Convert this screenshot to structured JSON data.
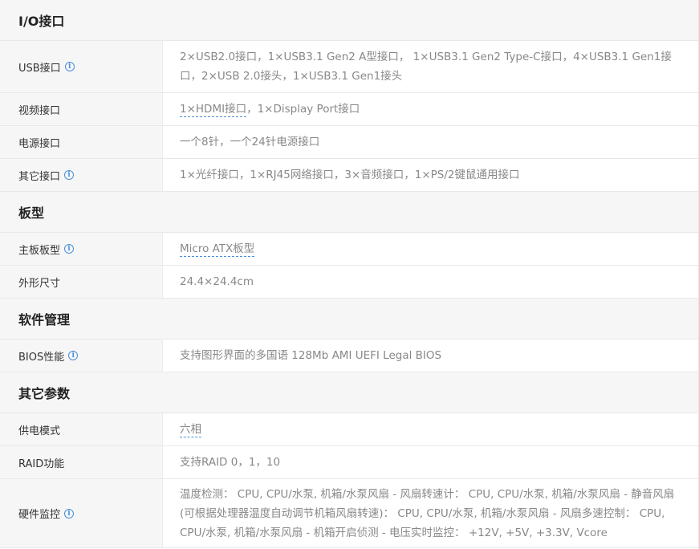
{
  "sections": {
    "io": "I/O接口",
    "board": "板型",
    "software": "软件管理",
    "other": "其它参数"
  },
  "rows": {
    "usb": {
      "label": "USB接口",
      "value": "2×USB2.0接口，1×USB3.1 Gen2 A型接口， 1×USB3.1 Gen2 Type-C接口，4×USB3.1 Gen1接口，2×USB 2.0接头，1×USB3.1 Gen1接头"
    },
    "video": {
      "label": "视频接口",
      "value_link": "1×HDMI接口",
      "value_rest": "，1×Display Port接口"
    },
    "power": {
      "label": "电源接口",
      "value": "一个8针，一个24针电源接口"
    },
    "other_ports": {
      "label": "其它接口",
      "value": "1×光纤接口，1×RJ45网络接口，3×音频接口，1×PS/2键鼠通用接口"
    },
    "form": {
      "label": "主板板型",
      "value": "Micro ATX板型"
    },
    "size": {
      "label": "外形尺寸",
      "value": "24.4×24.4cm"
    },
    "bios": {
      "label": "BIOS性能",
      "value": "支持图形界面的多国语 128Mb AMI UEFI Legal BIOS"
    },
    "phase": {
      "label": "供电模式",
      "value": "六相"
    },
    "raid": {
      "label": "RAID功能",
      "value": "支持RAID 0，1，10"
    },
    "monitor": {
      "label": "硬件监控",
      "value": "温度检测： CPU, CPU/水泵, 机箱/水泵风扇 - 风扇转速计： CPU, CPU/水泵, 机箱/水泵风扇 - 静音风扇 (可根据处理器温度自动调节机箱风扇转速)： CPU, CPU/水泵, 机箱/水泵风扇 - 风扇多速控制： CPU, CPU/水泵, 机箱/水泵风扇 - 机箱开启侦测 - 电压实时监控： +12V, +5V, +3.3V, Vcore"
    }
  },
  "icons": {
    "info": "info-icon"
  },
  "colors": {
    "accent": "#4a90d9",
    "header_bg": "#f6f6f6",
    "value_text": "#888888"
  }
}
